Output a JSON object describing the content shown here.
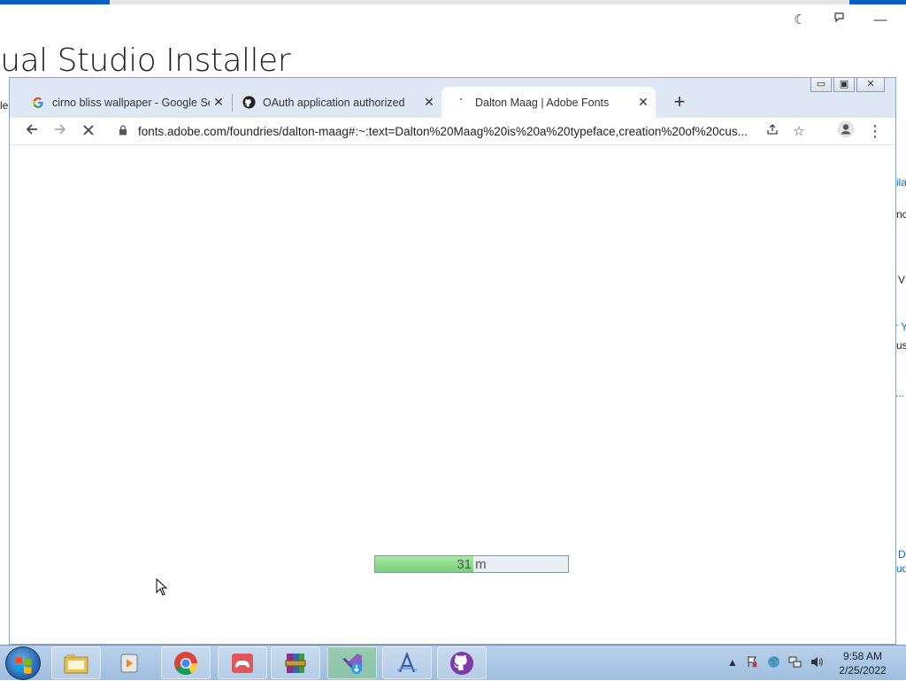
{
  "background_app": {
    "title": "sual Studio Installer",
    "fragments": {
      "left_le": "le",
      "right_ila": "ila",
      "right_nc": "nc",
      "right_v": "V",
      "right_y": "r Y",
      "right_us": "us",
      "right_dots": "...",
      "right_d": "D",
      "right_ud": "ud"
    }
  },
  "browser": {
    "tabs": [
      {
        "label": "cirno bliss wallpaper - Google Se",
        "favicon": "google-icon"
      },
      {
        "label": "OAuth application authorized",
        "favicon": "github-icon"
      },
      {
        "label": "Dalton Maag | Adobe Fonts",
        "favicon": "loading-icon",
        "active": true
      }
    ],
    "new_tab_label": "+",
    "url": "fonts.adobe.com/foundries/dalton-maag#:~:text=Dalton%20Maag%20is%20a%20typeface,creation%20of%20cus..."
  },
  "overlay_progress": {
    "text": "31 m",
    "fraction": 0.51
  },
  "taskbar": {
    "apps": [
      "file-explorer-icon",
      "media-player-icon",
      "chrome-icon",
      "game-controller-icon",
      "winrar-icon",
      "visual-studio-installer-icon",
      "font-app-icon",
      "github-desktop-icon"
    ],
    "clock_time": "9:58 AM",
    "clock_date": "2/25/2022"
  },
  "colors": {
    "chrome_frame": "#dfe9f5",
    "progress_fill": "#79d07a",
    "taskbar": "#b9d1ea"
  }
}
